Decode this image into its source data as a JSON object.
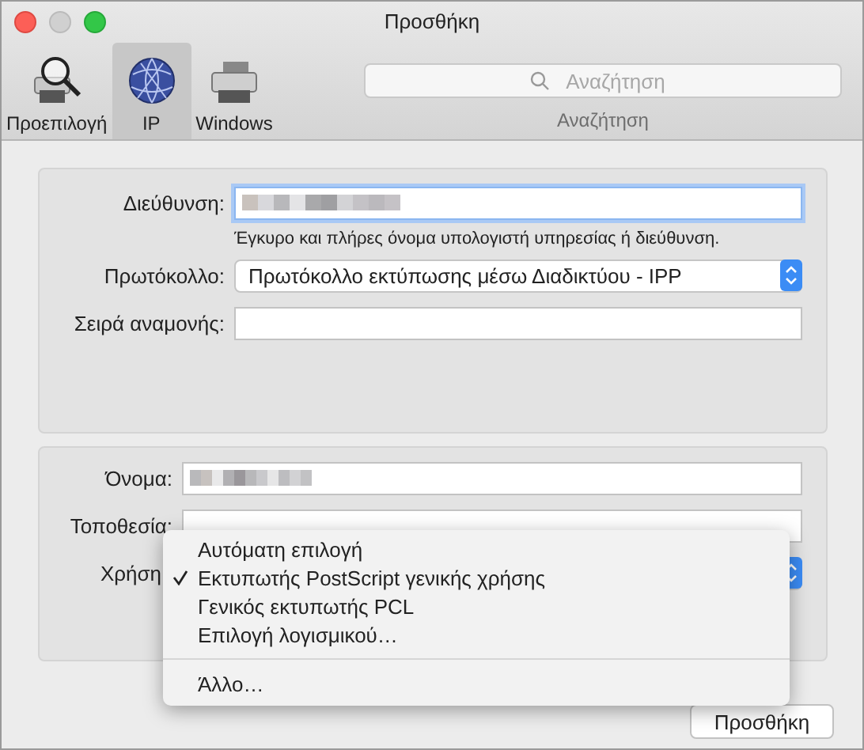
{
  "window": {
    "title": "Προσθήκη"
  },
  "toolbar": {
    "tabs": [
      {
        "label": "Προεπιλογή",
        "selected": false
      },
      {
        "label": "IP",
        "selected": true
      },
      {
        "label": "Windows",
        "selected": false
      }
    ],
    "search": {
      "placeholder": "Αναζήτηση",
      "label": "Αναζήτηση"
    }
  },
  "connection": {
    "address_label": "Διεύθυνση:",
    "address_hint": "Έγκυρο και πλήρες όνομα υπολογιστή υπηρεσίας ή διεύθυνση.",
    "protocol_label": "Πρωτόκολλο:",
    "protocol_value": "Πρωτόκολλο εκτύπωσης μέσω Διαδικτύου - IPP",
    "queue_label": "Σειρά αναμονής:"
  },
  "printer": {
    "name_label": "Όνομα:",
    "location_label": "Τοποθεσία:",
    "use_label": "Χρήση"
  },
  "use_menu": {
    "sections": [
      [
        {
          "label": "Αυτόματη επιλογή",
          "checked": false
        },
        {
          "label": "Εκτυπωτής PostScript γενικής χρήσης",
          "checked": true
        },
        {
          "label": "Γενικός εκτυπωτής PCL",
          "checked": false
        },
        {
          "label": "Επιλογή λογισμικού…",
          "checked": false
        }
      ],
      [
        {
          "label": "Άλλο…",
          "checked": false
        }
      ]
    ]
  },
  "buttons": [
    "Προσθήκη"
  ]
}
